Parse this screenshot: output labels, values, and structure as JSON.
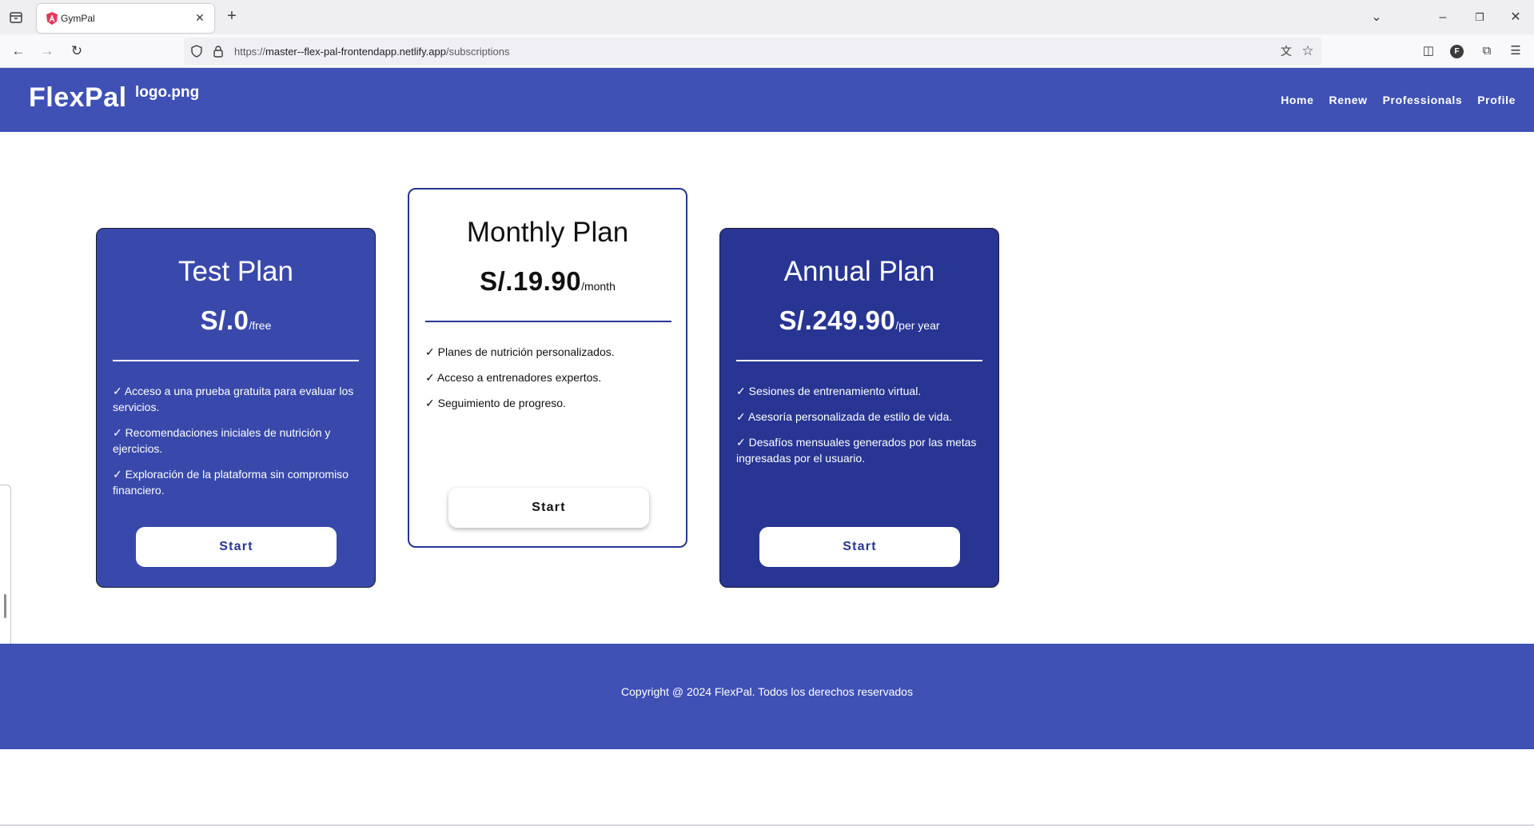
{
  "browser": {
    "tab_title": "GymPal",
    "url_prefix": "https://",
    "url_host": "master--flex-pal-frontendapp.netlify.app",
    "url_path": "/subscriptions",
    "profile_initial": "F"
  },
  "header": {
    "brand": "FlexPal",
    "logo_alt": "logo.png",
    "menu": [
      "Home",
      "Renew",
      "Professionals",
      "Profile"
    ]
  },
  "plans": [
    {
      "title": "Test Plan",
      "amount": "S/.0",
      "period": "/free",
      "features": [
        "✓ Acceso a una prueba gratuita para evaluar los servicios.",
        "✓ Recomendaciones iniciales de nutrición y ejercicios.",
        "✓ Exploración de la plataforma sin compromiso financiero."
      ],
      "button": "Start"
    },
    {
      "title": "Monthly Plan",
      "amount": "S/.19.90",
      "period": "/month",
      "features": [
        "✓ Planes de nutrición personalizados.",
        "✓ Acceso a entrenadores expertos.",
        "✓ Seguimiento de progreso."
      ],
      "button": "Start"
    },
    {
      "title": "Annual Plan",
      "amount": "S/.249.90",
      "period": "/per year",
      "features": [
        "✓ Sesiones de entrenamiento virtual.",
        "✓ Asesoría personalizada de estilo de vida.",
        "✓ Desafíos mensuales generados por las metas ingresadas por el usuario."
      ],
      "button": "Start"
    }
  ],
  "footer": {
    "text": "Copyright @ 2024 FlexPal. Todos los derechos reservados"
  },
  "colors": {
    "primary": "#3f51b5",
    "card_blue": "#3949ab",
    "card_dark": "#283593"
  }
}
